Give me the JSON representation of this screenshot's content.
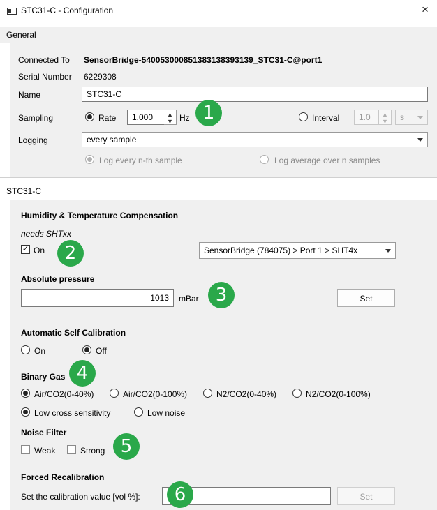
{
  "window": {
    "title": "STC31-C - Configuration",
    "close_symbol": "×"
  },
  "general": {
    "header": "General",
    "connected_to_label": "Connected To",
    "connected_to_value": "SensorBridge-5400530008513831383931​39_STC31-C@port1",
    "serial_label": "Serial Number",
    "serial_value": "6229308",
    "name_label": "Name",
    "name_value": "STC31-C",
    "sampling_label": "Sampling",
    "rate_label": "Rate",
    "rate_value": "1.000",
    "rate_unit": "Hz",
    "interval_label": "Interval",
    "interval_value": "1.0",
    "interval_unit": "s",
    "logging_label": "Logging",
    "logging_value": "every sample",
    "log_nth_label": "Log every n-th sample",
    "log_avg_label": "Log average over n samples"
  },
  "device": {
    "header": "STC31-C",
    "hum_temp_title": "Humidity & Temperature Compensation",
    "needs_note": "needs SHTxx",
    "on_label": "On",
    "sensor_source": "SensorBridge (784075) > Port 1 > SHT4x",
    "abs_pressure_title": "Absolute pressure",
    "pressure_value": "1013",
    "pressure_unit": "mBar",
    "set_label": "Set",
    "asc_title": "Automatic Self Calibration",
    "asc_on": "On",
    "asc_off": "Off",
    "binary_gas_title": "Binary Gas",
    "gas_options": [
      "Air/CO2(0-40%)",
      "Air/CO2(0-100%)",
      "N2/CO2(0-40%)",
      "N2/CO2(0-100%)"
    ],
    "low_cross_label": "Low cross sensitivity",
    "low_noise_label": "Low noise",
    "noise_filter_title": "Noise Filter",
    "weak_label": "Weak",
    "strong_label": "Strong",
    "forced_recal_title": "Forced Recalibration",
    "calibration_label": "Set the calibration value [vol %]:",
    "calibration_value": "",
    "set_disabled_label": "Set"
  },
  "annotations": [
    "1",
    "2",
    "3",
    "4",
    "5",
    "6"
  ],
  "colors": {
    "badge": "#2aa84a",
    "panel_bg": "#f0f0f0"
  }
}
